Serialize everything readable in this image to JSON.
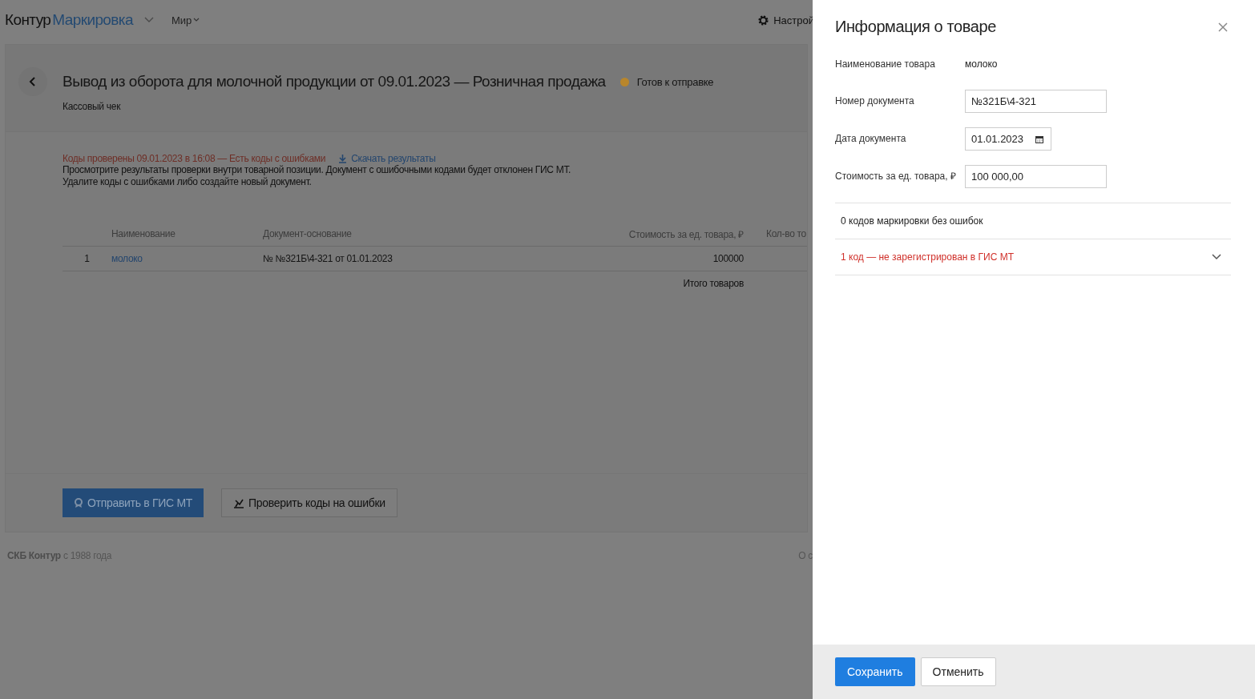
{
  "header": {
    "logo_main": "Контур",
    "logo_product": "Маркировка",
    "org": "Мир",
    "settings": "Настрой"
  },
  "document": {
    "title": "Вывод из оборота для молочной продукции от 09.01.2023 — Розничная продажа",
    "status": "Готов к отправке",
    "subtitle": "Кассовый чек"
  },
  "check": {
    "result": "Коды проверены 09.01.2023 в 16:08 — Есть коды с ошибками",
    "download": "Скачать результаты",
    "note_1": "Просмотрите результаты проверки внутри товарной позиции. Документ с ошибочными кодами будет отклонен ГИС МТ.",
    "note_2": "Удалите коды с ошибками либо создайте новый документ."
  },
  "table": {
    "columns": [
      "Наименование",
      "Документ-основание",
      "Стоимость за ед. товара, ₽",
      "Кол-во то"
    ],
    "rows": [
      {
        "index": "1",
        "name": "молоко",
        "document": "№ №321Б\\4-321 от 01.01.2023",
        "price": "100000"
      }
    ],
    "total_label": "Итого товаров"
  },
  "actions": {
    "send": "Отправить в ГИС МТ",
    "verify": "Проверить коды на ошибки"
  },
  "footer": {
    "company": "СКБ Контур",
    "since": "с 1988 года",
    "right": "О с"
  },
  "drawer": {
    "title": "Информация о товаре",
    "fields": [
      {
        "kind": "static",
        "label": "Наименование товара",
        "value": "молоко"
      },
      {
        "kind": "text",
        "label": "Номер документа",
        "value": "№321Б\\4-321"
      },
      {
        "kind": "date",
        "label": "Дата документа",
        "value": "01.01.2023"
      },
      {
        "kind": "text",
        "label": "Стоимость за ед. товара, ₽",
        "value": "100 000,00"
      }
    ],
    "groups": [
      {
        "label": "0 кодов маркировки без ошибок",
        "error": false,
        "expandable": false
      },
      {
        "label": "1 код — не зарегистрирован в ГИС МТ",
        "error": true,
        "expanded": false,
        "expandable": true
      }
    ],
    "save": "Сохранить",
    "cancel": "Отменить"
  }
}
